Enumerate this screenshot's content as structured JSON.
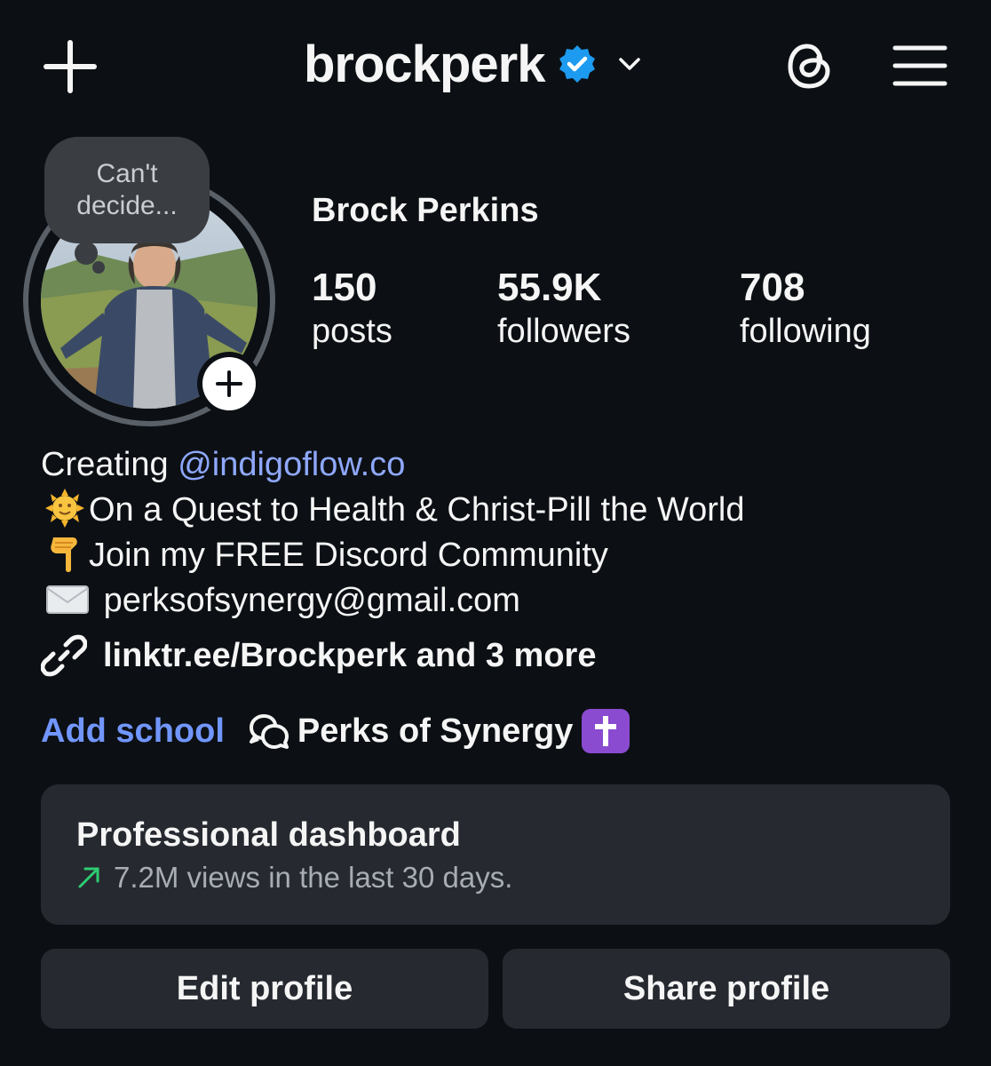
{
  "header": {
    "username": "brockperk",
    "icons": [
      "plus-icon",
      "verified-badge-icon",
      "chevron-down-icon",
      "threads-icon",
      "hamburger-menu-icon"
    ],
    "accent_verified": "#1d9bf0"
  },
  "profile": {
    "note": "Can't decide...",
    "full_name": "Brock Perkins",
    "stats": {
      "posts": {
        "value": "150",
        "label": "posts"
      },
      "followers": {
        "value": "55.9K",
        "label": "followers"
      },
      "following": {
        "value": "708",
        "label": "following"
      }
    }
  },
  "bio": {
    "line1_prefix": "Creating ",
    "line1_mention": "@indigoflow.co",
    "line2": "On a Quest to Health & Christ-Pill the World",
    "line3": "Join my FREE Discord Community",
    "line4": "perksofsynergy@gmail.com",
    "link": "linktr.ee/Brockperk and 3 more"
  },
  "meta": {
    "add_school": "Add school",
    "community": "Perks of Synergy"
  },
  "dashboard": {
    "title": "Professional dashboard",
    "subtitle": "7.2M views in the last 30 days.",
    "trend_color": "#2ecc71"
  },
  "actions": {
    "edit": "Edit profile",
    "share": "Share profile"
  }
}
